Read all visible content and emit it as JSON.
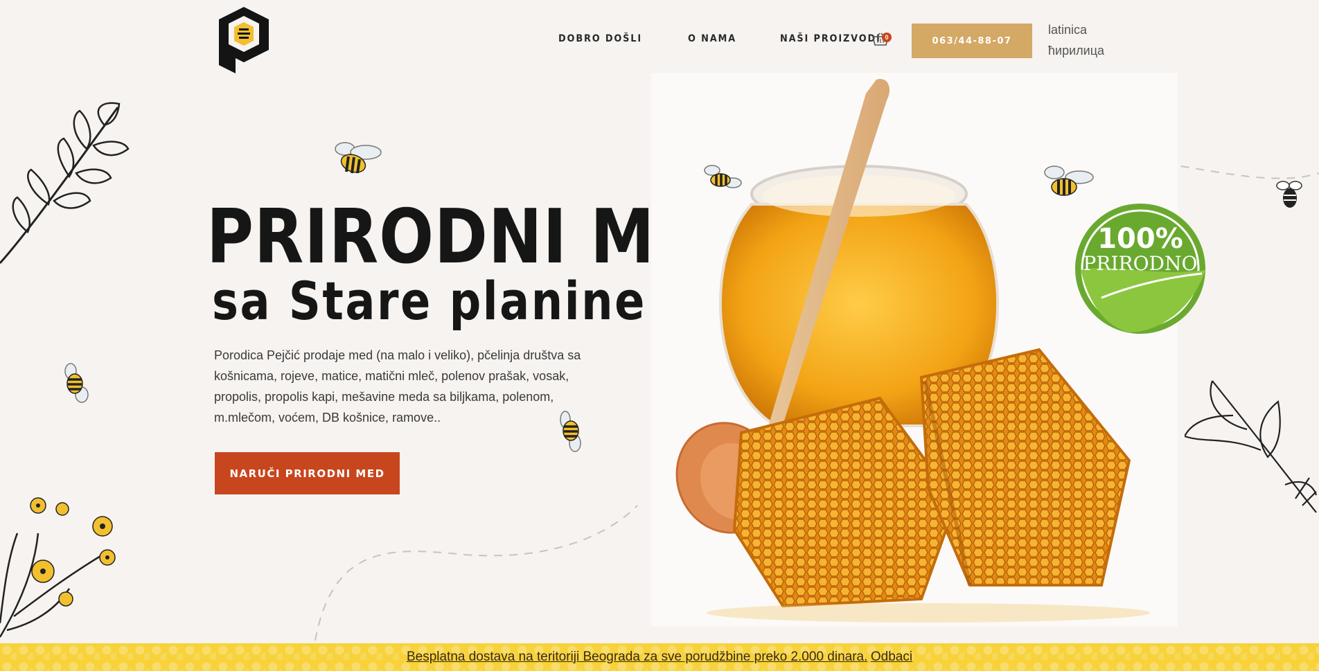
{
  "header": {
    "nav": [
      {
        "label": "DOBRO DOŠLI"
      },
      {
        "label": "O NAMA"
      },
      {
        "label": "NAŠI PROIZVODI"
      }
    ],
    "cart_count": "0",
    "phone": "063/44-88-07",
    "languages": [
      "latinica",
      "ћирилица"
    ]
  },
  "hero": {
    "title": "PRIRODNI MED",
    "subtitle": "sa Stare planine",
    "description": "Porodica Pejčić prodaje med (na malo i veliko), pčelinja društva sa košnicama, rojeve, matice, matični mleč, polenov prašak, vosak, propolis, propolis kapi, mešavine meda sa biljkama, polenom, m.mlečom, voćem, DB košnice, ramove..",
    "cta": "NARUČI PRIRODNI MED"
  },
  "badge": {
    "percent": "100%",
    "label": "PRIRODNO"
  },
  "notice": {
    "text": "Besplatna dostava na teritoriji Beograda za sve porudžbine preko 2.000 dinara.",
    "dismiss": "Odbaci"
  },
  "colors": {
    "background": "#f6f3f0",
    "accent_gold": "#d4a865",
    "cta_red": "#c8461e",
    "notice_yellow": "#f7d23a"
  }
}
